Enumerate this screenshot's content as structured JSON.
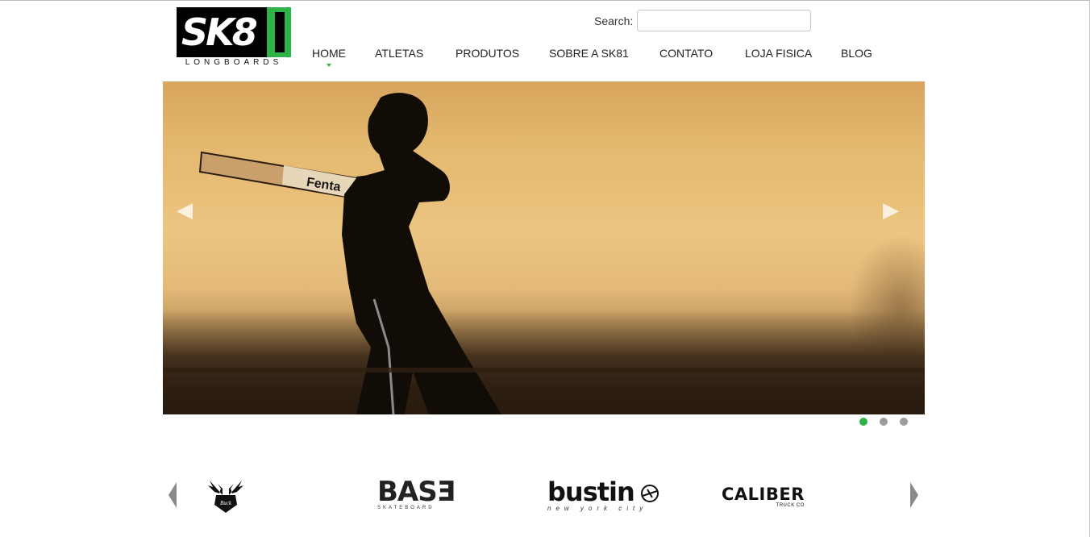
{
  "logo": {
    "main": "SK8",
    "sub": "LONGBOARDS"
  },
  "search": {
    "label": "Search:",
    "value": "",
    "placeholder": ""
  },
  "nav": {
    "items": [
      {
        "label": "HOME",
        "active": true
      },
      {
        "label": "ATLETAS"
      },
      {
        "label": "PRODUTOS"
      },
      {
        "label": "SOBRE A SK81"
      },
      {
        "label": "CONTATO"
      },
      {
        "label": "LOJA FISICA"
      },
      {
        "label": "BLOG"
      }
    ]
  },
  "slider": {
    "prev_icon": "chevron-left-icon",
    "next_icon": "chevron-right-icon",
    "dots": 3,
    "active_dot": 1
  },
  "colors": {
    "accent": "#2db34a",
    "inactive_dot": "#9c9c9c"
  },
  "brands": [
    {
      "name": "deer-logo",
      "icon": "deer-antler-icon"
    },
    {
      "name": "BASE",
      "text": "BASƎ",
      "sub": "SKATEBOARD"
    },
    {
      "name": "bustin",
      "text": "bustin",
      "sub": "new york city"
    },
    {
      "name": "caliber",
      "text": "CALIBER",
      "sub": "TRUCK CO"
    }
  ]
}
